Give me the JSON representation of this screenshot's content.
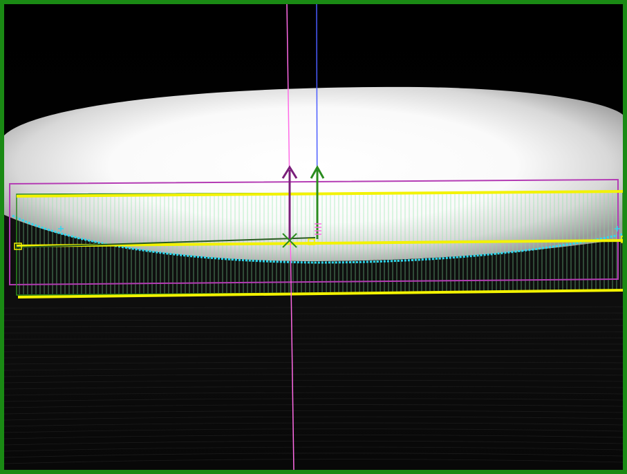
{
  "viewer": {
    "frame_color": "#1a8a14"
  },
  "overlay_colors": {
    "magenta": "#b43cb4",
    "dark_magenta": "#7a1f7a",
    "green": "#2a8c1e",
    "blue": "#4a5cff",
    "pink": "#ff6ae6",
    "yellow": "#f2f200",
    "cyan": "#2fd8f0",
    "tick_green": "#86e7a0"
  },
  "icons": {
    "up_arrow": "up-arrow-icon",
    "edge_point": "x-mark-icon",
    "handle": "square-handle-icon"
  }
}
